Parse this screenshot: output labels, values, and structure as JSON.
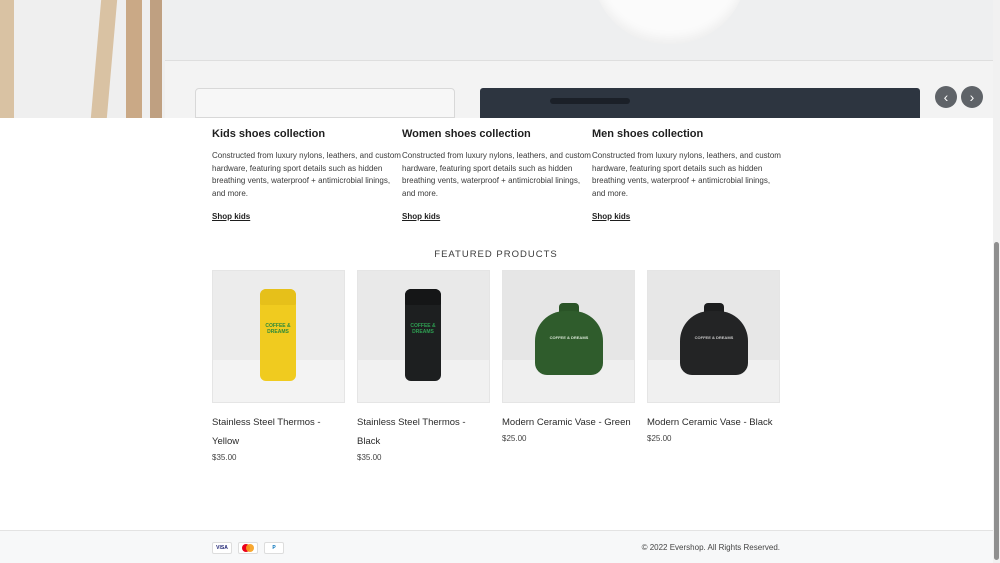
{
  "hero": {
    "prev_icon": "chevron-left-icon",
    "next_icon": "chevron-right-icon",
    "prev_glyph": "‹",
    "next_glyph": "›"
  },
  "collections": [
    {
      "title": "Kids shoes collection",
      "description": "Constructed from luxury nylons, leathers, and custom hardware, featuring sport details such as hidden breathing vents, waterproof + antimicrobial linings, and more.",
      "link": "Shop kids"
    },
    {
      "title": "Women shoes collection",
      "description": "Constructed from luxury nylons, leathers, and custom hardware, featuring sport details such as hidden breathing vents, waterproof + antimicrobial linings, and more.",
      "link": "Shop kids"
    },
    {
      "title": "Men shoes collection",
      "description": "Constructed from luxury nylons, leathers, and custom hardware, featuring sport details such as hidden breathing vents, waterproof + antimicrobial linings, and more.",
      "link": "Shop kids"
    }
  ],
  "featured": {
    "title": "FEATURED PRODUCTS",
    "products": [
      {
        "name": "Stainless Steel Thermos - Yellow",
        "price": "$35.00",
        "color": "#f0cb1f",
        "logo_text": "COFFEE & DREAMS",
        "logo_color": "#2c8a3a"
      },
      {
        "name": "Stainless Steel Thermos - Black",
        "price": "$35.00",
        "color": "#1d1f20",
        "logo_text": "COFFEE & DREAMS",
        "logo_color": "#2e9f52"
      },
      {
        "name": "Modern Ceramic Vase - Green",
        "price": "$25.00",
        "color": "#2f5c2c",
        "logo_text": "COFFEE & DREAMS",
        "logo_color": "#d8e6d5"
      },
      {
        "name": "Modern Ceramic Vase - Black",
        "price": "$25.00",
        "color": "#232425",
        "logo_text": "COFFEE & DREAMS",
        "logo_color": "#c9c9c9"
      }
    ]
  },
  "footer": {
    "payments": [
      "VISA",
      "mastercard",
      "P"
    ],
    "copyright": "© 2022 Evershop. All Rights Reserved."
  }
}
